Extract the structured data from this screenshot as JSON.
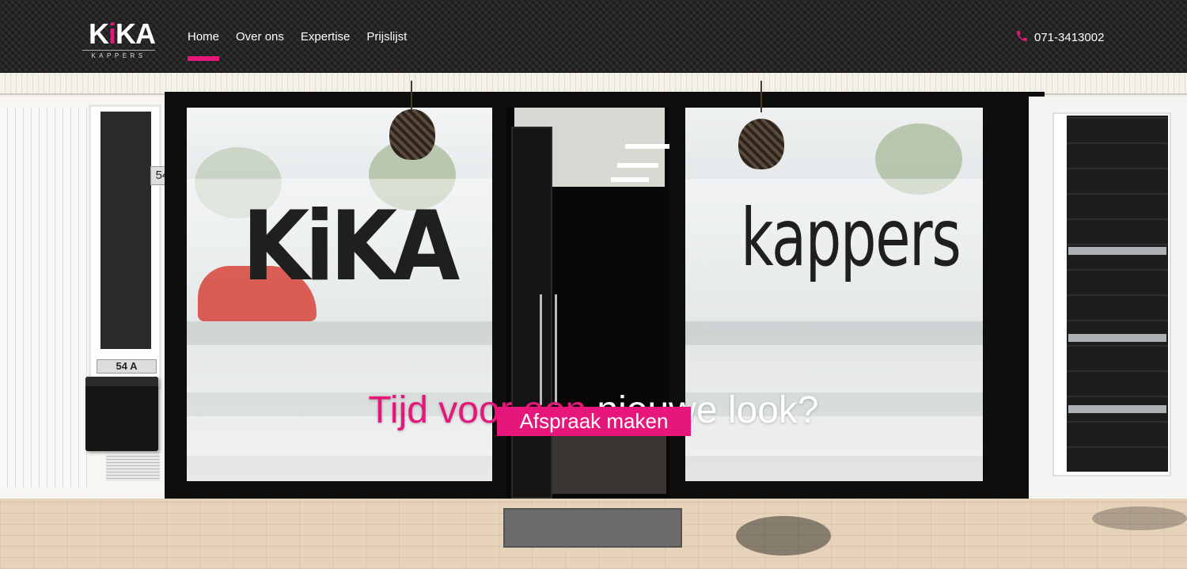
{
  "header": {
    "logo": {
      "letter_k": "K",
      "letter_i": "i",
      "letters_ka": "KA",
      "subtitle": "KAPPERS"
    },
    "nav": [
      {
        "label": "Home",
        "active": true
      },
      {
        "label": "Over ons",
        "active": false
      },
      {
        "label": "Expertise",
        "active": false
      },
      {
        "label": "Prijslijst",
        "active": false
      }
    ],
    "phone": {
      "icon": "phone-icon",
      "number": "071-3413002"
    }
  },
  "hero": {
    "title_highlight": "Tijd voor een",
    "title_rest": "nieuwe look?",
    "cta_label": "Afspraak maken",
    "photo_text": {
      "house_number": "54",
      "house_number_b": "54 A",
      "window_left": "KiKA",
      "window_right": "kappers"
    }
  },
  "colors": {
    "accent": "#e6167a",
    "header_bg": "#222222",
    "text": "#ffffff"
  }
}
